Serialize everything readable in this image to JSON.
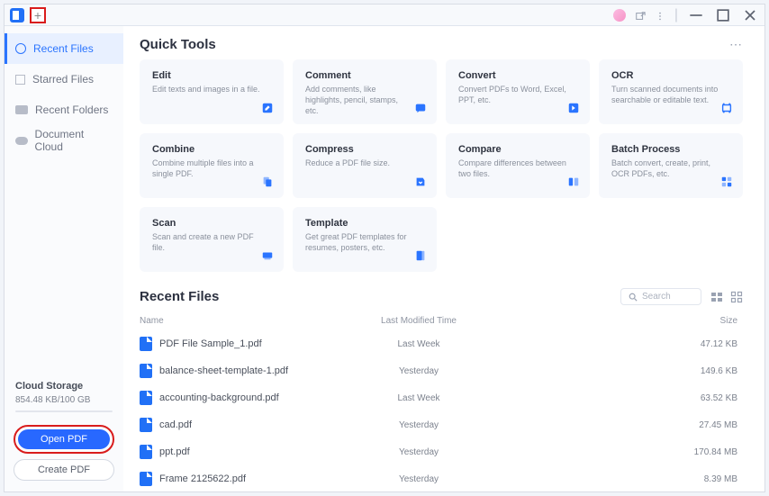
{
  "titlebar": {
    "plus": "+"
  },
  "sidebar": {
    "items": [
      {
        "label": "Recent Files",
        "active": true
      },
      {
        "label": "Starred Files",
        "active": false
      },
      {
        "label": "Recent Folders",
        "active": false
      },
      {
        "label": "Document Cloud",
        "active": false
      }
    ],
    "cloud": {
      "title": "Cloud Storage",
      "usage": "854.48 KB/100 GB"
    },
    "open_btn": "Open PDF",
    "create_btn": "Create PDF"
  },
  "quick_tools": {
    "title": "Quick Tools",
    "tools": [
      {
        "title": "Edit",
        "desc": "Edit texts and images in a file.",
        "color": "#2a74ff"
      },
      {
        "title": "Comment",
        "desc": "Add comments, like highlights, pencil, stamps, etc.",
        "color": "#2a74ff"
      },
      {
        "title": "Convert",
        "desc": "Convert PDFs to Word, Excel, PPT, etc.",
        "color": "#2a74ff"
      },
      {
        "title": "OCR",
        "desc": "Turn scanned documents into searchable or editable text.",
        "color": "#2a74ff"
      },
      {
        "title": "Combine",
        "desc": "Combine multiple files into a single PDF.",
        "color": "#2a74ff"
      },
      {
        "title": "Compress",
        "desc": "Reduce a PDF file size.",
        "color": "#2a74ff"
      },
      {
        "title": "Compare",
        "desc": "Compare differences between two files.",
        "color": "#2a74ff"
      },
      {
        "title": "Batch Process",
        "desc": "Batch convert, create, print, OCR PDFs, etc.",
        "color": "#2a74ff"
      },
      {
        "title": "Scan",
        "desc": "Scan and create a new PDF file.",
        "color": "#2a74ff"
      },
      {
        "title": "Template",
        "desc": "Get great PDF templates for resumes, posters, etc.",
        "color": "#2a74ff"
      }
    ]
  },
  "recent": {
    "title": "Recent Files",
    "search_placeholder": "Search",
    "cols": {
      "name": "Name",
      "modified": "Last Modified Time",
      "size": "Size"
    },
    "rows": [
      {
        "name": "PDF File Sample_1.pdf",
        "modified": "Last Week",
        "size": "47.12 KB"
      },
      {
        "name": "balance-sheet-template-1.pdf",
        "modified": "Yesterday",
        "size": "149.6 KB"
      },
      {
        "name": "accounting-background.pdf",
        "modified": "Last Week",
        "size": "63.52 KB"
      },
      {
        "name": "cad.pdf",
        "modified": "Yesterday",
        "size": "27.45 MB"
      },
      {
        "name": "ppt.pdf",
        "modified": "Yesterday",
        "size": "170.84 MB"
      },
      {
        "name": "Frame 2125622.pdf",
        "modified": "Yesterday",
        "size": "8.39 MB"
      }
    ]
  }
}
